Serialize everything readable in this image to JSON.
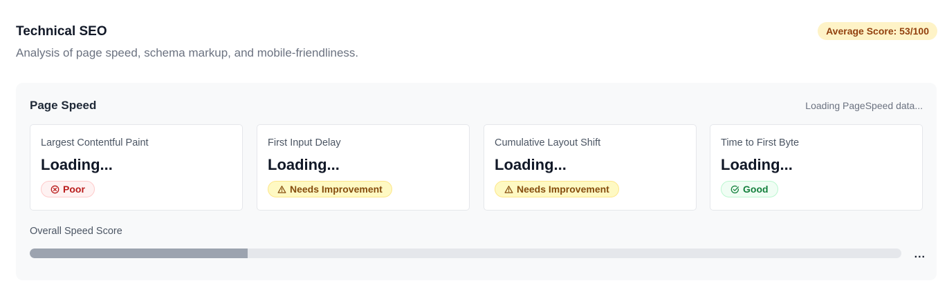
{
  "header": {
    "title": "Technical SEO",
    "subtitle": "Analysis of page speed, schema markup, and mobile-friendliness.",
    "average_score": "Average Score: 53/100"
  },
  "page_speed": {
    "title": "Page Speed",
    "status": "Loading PageSpeed data...",
    "metrics": [
      {
        "name": "Largest Contentful Paint",
        "value": "Loading...",
        "status": "Poor",
        "status_type": "poor",
        "icon": "x-circle-icon"
      },
      {
        "name": "First Input Delay",
        "value": "Loading...",
        "status": "Needs Improvement",
        "status_type": "warn",
        "icon": "warning-triangle-icon"
      },
      {
        "name": "Cumulative Layout Shift",
        "value": "Loading...",
        "status": "Needs Improvement",
        "status_type": "warn",
        "icon": "warning-triangle-icon"
      },
      {
        "name": "Time to First Byte",
        "value": "Loading...",
        "status": "Good",
        "status_type": "good",
        "icon": "check-circle-icon"
      }
    ],
    "overall_label": "Overall Speed Score",
    "overall_value": "...",
    "overall_progress_percent": 25
  },
  "colors": {
    "poor": "#b91c1c",
    "warn": "#854d0e",
    "good": "#15803d",
    "badge_avg_bg": "#fef3c7"
  }
}
